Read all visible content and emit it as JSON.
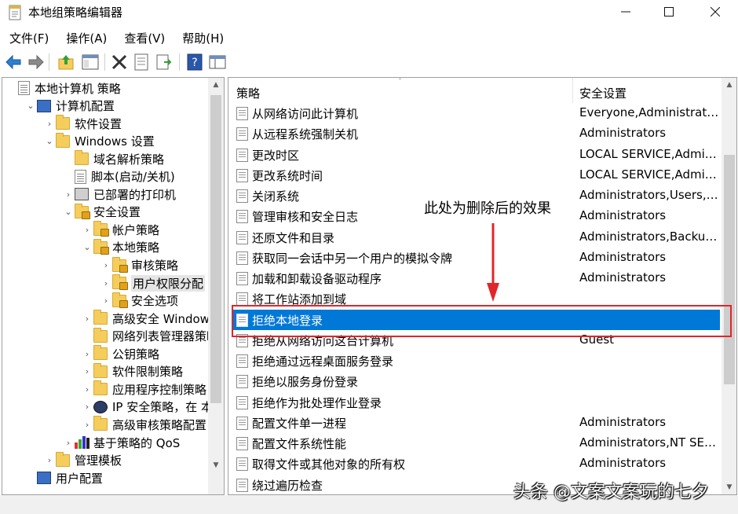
{
  "window": {
    "title": "本地组策略编辑器"
  },
  "menu": [
    "文件(F)",
    "操作(A)",
    "查看(V)",
    "帮助(H)"
  ],
  "toolbar": {
    "icons": [
      "back-arrow-icon",
      "forward-arrow-icon",
      "up-folder-icon",
      "show-tree-icon",
      "delete-icon",
      "properties-icon",
      "export-list-icon",
      "help-icon",
      "console-view-icon"
    ]
  },
  "tree": [
    {
      "label": "本地计算机 策略",
      "icon": "doc",
      "toggle": "",
      "indent": 0
    },
    {
      "label": "计算机配置",
      "icon": "pc",
      "toggle": "⌄",
      "indent": 1
    },
    {
      "label": "软件设置",
      "icon": "folder",
      "toggle": "›",
      "indent": 2
    },
    {
      "label": "Windows 设置",
      "icon": "folder",
      "toggle": "⌄",
      "indent": 2
    },
    {
      "label": "域名解析策略",
      "icon": "folder",
      "toggle": "",
      "indent": 3
    },
    {
      "label": "脚本(启动/关机)",
      "icon": "doc",
      "toggle": "",
      "indent": 3
    },
    {
      "label": "已部署的打印机",
      "icon": "printer",
      "toggle": "›",
      "indent": 3
    },
    {
      "label": "安全设置",
      "icon": "folder-lock",
      "toggle": "⌄",
      "indent": 3
    },
    {
      "label": "帐户策略",
      "icon": "folder-lock",
      "toggle": "›",
      "indent": 4
    },
    {
      "label": "本地策略",
      "icon": "folder-lock",
      "toggle": "⌄",
      "indent": 4
    },
    {
      "label": "审核策略",
      "icon": "folder-lock",
      "toggle": "›",
      "indent": 5
    },
    {
      "label": "用户权限分配",
      "icon": "folder-lock",
      "toggle": "›",
      "indent": 5,
      "selected": true
    },
    {
      "label": "安全选项",
      "icon": "folder-lock",
      "toggle": "›",
      "indent": 5
    },
    {
      "label": "高级安全 Windows D",
      "icon": "folder",
      "toggle": "›",
      "indent": 4
    },
    {
      "label": "网络列表管理器策略",
      "icon": "folder",
      "toggle": "",
      "indent": 4
    },
    {
      "label": "公钥策略",
      "icon": "folder",
      "toggle": "›",
      "indent": 4
    },
    {
      "label": "软件限制策略",
      "icon": "folder",
      "toggle": "›",
      "indent": 4
    },
    {
      "label": "应用程序控制策略",
      "icon": "folder",
      "toggle": "›",
      "indent": 4
    },
    {
      "label": "IP 安全策略，在 本地",
      "icon": "ipsec",
      "toggle": "›",
      "indent": 4
    },
    {
      "label": "高级审核策略配置",
      "icon": "folder",
      "toggle": "›",
      "indent": 4
    },
    {
      "label": "基于策略的 QoS",
      "icon": "chart",
      "toggle": "›",
      "indent": 3
    },
    {
      "label": "管理模板",
      "icon": "folder",
      "toggle": "›",
      "indent": 2
    },
    {
      "label": "用户配置",
      "icon": "pc",
      "toggle": "",
      "indent": 1
    }
  ],
  "list": {
    "columns": {
      "policy": "策略",
      "setting": "安全设置"
    },
    "rows": [
      {
        "policy": "从网络访问此计算机",
        "setting": "Everyone,Administrator..."
      },
      {
        "policy": "从远程系统强制关机",
        "setting": "Administrators"
      },
      {
        "policy": "更改时区",
        "setting": "LOCAL SERVICE,Admini..."
      },
      {
        "policy": "更改系统时间",
        "setting": "LOCAL SERVICE,Admini..."
      },
      {
        "policy": "关闭系统",
        "setting": "Administrators,Users,Ba..."
      },
      {
        "policy": "管理审核和安全日志",
        "setting": "Administrators"
      },
      {
        "policy": "还原文件和目录",
        "setting": "Administrators,Backup ..."
      },
      {
        "policy": "获取同一会话中另一个用户的模拟令牌",
        "setting": "Administrators"
      },
      {
        "policy": "加载和卸载设备驱动程序",
        "setting": "Administrators"
      },
      {
        "policy": "将工作站添加到域",
        "setting": ""
      },
      {
        "policy": "拒绝本地登录",
        "setting": "",
        "selected": true
      },
      {
        "policy": "拒绝从网络访问这台计算机",
        "setting": "Guest"
      },
      {
        "policy": "拒绝通过远程桌面服务登录",
        "setting": ""
      },
      {
        "policy": "拒绝以服务身份登录",
        "setting": ""
      },
      {
        "policy": "拒绝作为批处理作业登录",
        "setting": ""
      },
      {
        "policy": "配置文件单一进程",
        "setting": "Administrators"
      },
      {
        "policy": "配置文件系统性能",
        "setting": "Administrators,NT SER..."
      },
      {
        "policy": "取得文件或其他对象的所有权",
        "setting": "Administrators"
      },
      {
        "policy": "绕过遍历检查",
        "setting": ""
      }
    ]
  },
  "annotation": {
    "text": "此处为删除后的效果",
    "color": "#e0262b"
  },
  "watermark": "头条 @文案文案玩的七夕",
  "colors": {
    "selection": "#0078d7",
    "annotation_red": "#e0262b"
  }
}
